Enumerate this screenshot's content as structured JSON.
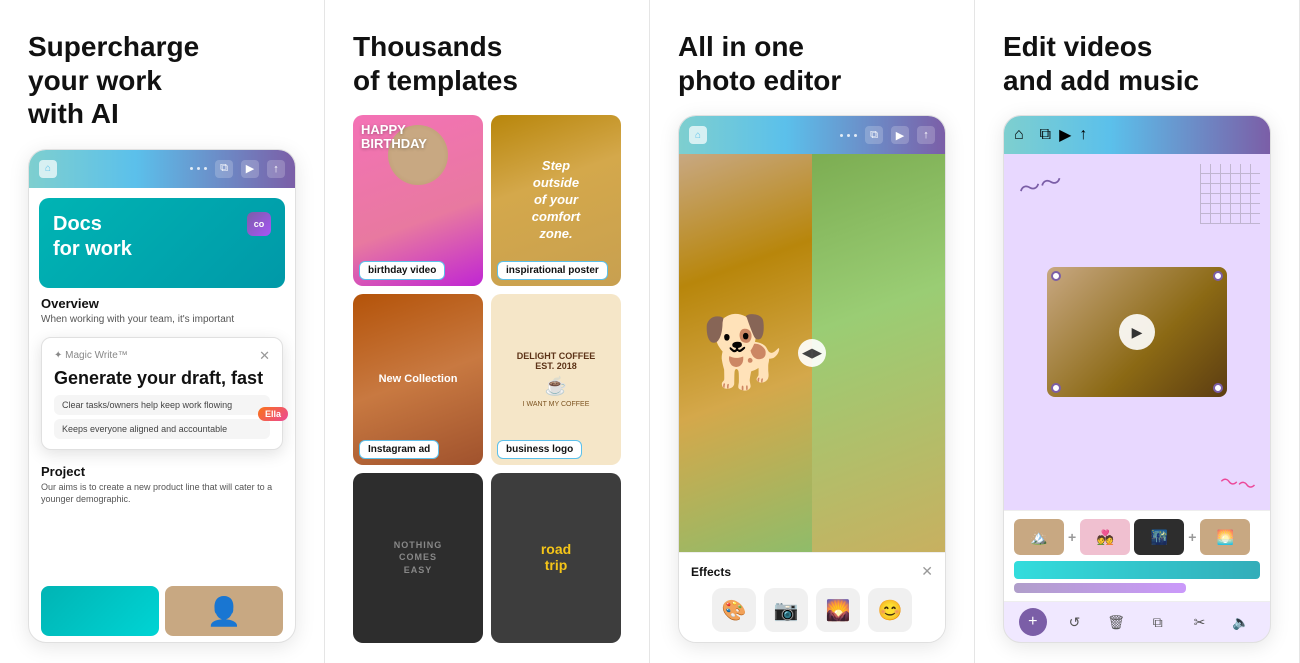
{
  "panels": [
    {
      "id": "panel1",
      "heading_line1": "Supercharge",
      "heading_line2": "your work",
      "heading_line3": "with AI",
      "docs_banner": "Docs\nfor work",
      "overview_title": "Overview",
      "overview_text": "When working with your team, it's important",
      "magic_write_label": "✦ Magic Write™",
      "magic_write_title": "Generate your draft, fast",
      "ella_badge": "Ella",
      "tasks": [
        "Clear tasks/owners help keep work flowing",
        "Keeps everyone aligned and accountable"
      ],
      "project_title": "Project",
      "project_text": "Our aims is to create a new product line that will cater to a younger demographic."
    },
    {
      "id": "panel2",
      "heading_line1": "Thousands",
      "heading_line2": "of templates",
      "templates": [
        {
          "label": "birthday video",
          "type": "birthday"
        },
        {
          "label": "inspirational poster",
          "type": "inspire"
        },
        {
          "label": "Instagram ad",
          "type": "instagram"
        },
        {
          "label": "business logo",
          "type": "coffee"
        },
        {
          "label": "nothing",
          "type": "nothing"
        },
        {
          "label": "road trip",
          "type": "roadtrip"
        }
      ]
    },
    {
      "id": "panel3",
      "heading_line1": "All in one",
      "heading_line2": "photo editor",
      "effects_title": "Effects",
      "effects": [
        "🎨",
        "📷",
        "🌄",
        "😊"
      ]
    },
    {
      "id": "panel4",
      "heading_line1": "Edit videos",
      "heading_line2": "and add music"
    }
  ]
}
